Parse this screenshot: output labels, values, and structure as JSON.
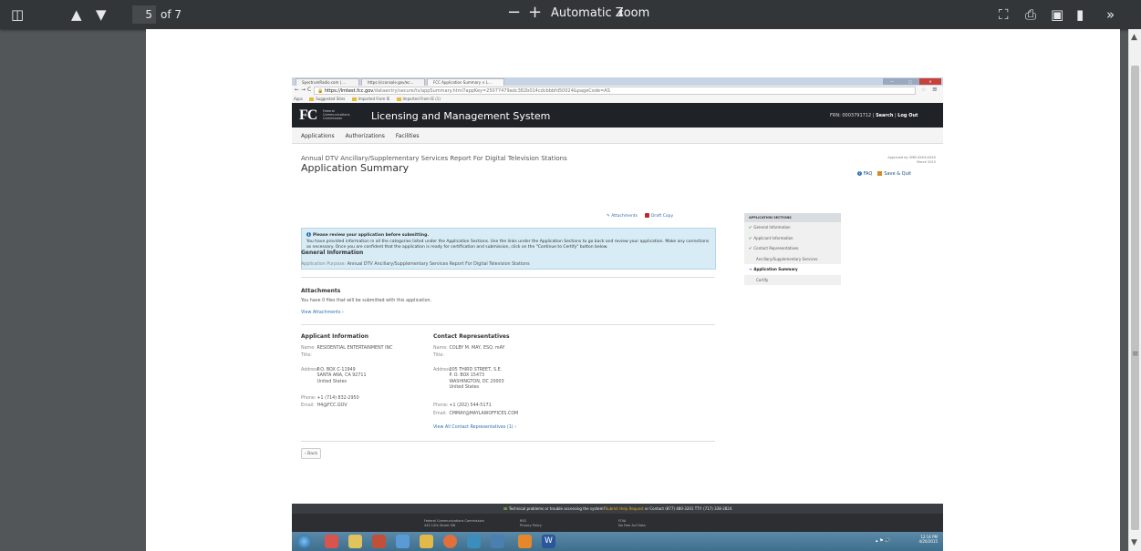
{
  "viewer": {
    "page_current": "5",
    "page_total": "of 7",
    "zoom_label": "Automatic Zoom",
    "zoom_out": "−",
    "zoom_in": "+"
  },
  "browser": {
    "tabs": [
      "SpectrumRadio.com | ...",
      "https://cconsole.gov/ec...",
      "FCC Application Summary × L..."
    ],
    "url_domain": "https://lmtest.fcc.gov",
    "url_rest": "/dataentry/secure/tv/appSummary.html?appKey=25077479adc382b014cdcbbbfd50024&pageCode=AS",
    "bookmarks": [
      "Apps",
      "Suggested Sites",
      "Imported From IE",
      "Imported From IE (1)"
    ]
  },
  "site": {
    "logo": "FC",
    "logo_sub": "Federal Communications Commission",
    "title": "Licensing and Management System",
    "frn": "FRN: 0003791712",
    "search": "Search",
    "logout": "Log Out",
    "nav": [
      "Applications",
      "Authorizations",
      "Facilities"
    ]
  },
  "page": {
    "subtitle": "Annual DTV Ancillary/Supplementary Services Report For Digital Television Stations",
    "title": "Application Summary",
    "omb_1": "Approved by OMB XXXX-XXXX",
    "omb_2": "March 2015",
    "faq": "FAQ",
    "save_quit": "Save & Quit",
    "attachments_link": "Attachments",
    "draft_copy": "Draft Copy"
  },
  "sections": {
    "header": "APPLICATION SECTIONS",
    "items": [
      {
        "label": "General Information",
        "state": "done"
      },
      {
        "label": "Applicant Information",
        "state": "done"
      },
      {
        "label": "Contact Representatives",
        "state": "done"
      },
      {
        "label": "Ancillary/Supplementary Services",
        "state": "none"
      },
      {
        "label": "Application Summary",
        "state": "current"
      },
      {
        "label": "Certify",
        "state": "none"
      }
    ]
  },
  "notice": {
    "heading": "Please review your application before submitting.",
    "body": "You have provided information in all the categories listed under the Application Sections. Use the links under the Application Sections to go back and review your application. Make any corrections as necessary. Once you are confident that the application is ready for certification and submission, click on the \"Continue to Certify\" button below."
  },
  "general": {
    "heading": "General Information",
    "purpose_label": "Application Purpose:",
    "purpose": "Annual DTV Ancillary/Supplementary Services Report For Digital Television Stations"
  },
  "attachments": {
    "heading": "Attachments",
    "text": "You have 0 files that will be submitted with this application.",
    "link": "View Attachments ›"
  },
  "applicant": {
    "heading": "Applicant Information",
    "name_label": "Name:",
    "name": "RESIDENTIAL ENTERTAINMENT INC",
    "title_label": "Title:",
    "address_label": "Address:",
    "address": [
      "P.O. BOX C-11949",
      "SANTA ANA, CA 92711",
      "United States"
    ],
    "phone_label": "Phone:",
    "phone": "+1 (714) 832-2950",
    "email_label": "Email:",
    "email": "H4@FCC.GOV"
  },
  "contact": {
    "heading": "Contact Representatives",
    "name_label": "Name:",
    "name": "COLBY M. MAY, ESQ. mAY",
    "title_label": "Title:",
    "address_label": "Address:",
    "address": [
      "205 THIRD STREET, S.E.",
      "P. O. BOX 15473",
      "WASHINGTON, DC 20003",
      "United States"
    ],
    "phone_label": "Phone:",
    "phone": "+1 (202) 544-5171",
    "email_label": "Email:",
    "email": "CMMAY@MAYLAWOFFICES.COM",
    "link": "View All Contact Representatives (1) ›"
  },
  "back_button": "‹ Back",
  "footer": {
    "help_pre": "Technical problems or trouble accessing the system?",
    "help_link": "Submit Help Request",
    "help_post": " or Contact (877) 480-3201 TTY: (717) 338-2824",
    "col1": [
      "Federal Communications Commission",
      "445 12th Street SW"
    ],
    "col2": [
      "RSS",
      "Privacy Policy"
    ],
    "col3": [
      "FOIA",
      "No Fear Act Data"
    ]
  },
  "taskbar": {
    "time": "12:14 PM",
    "date": "4/20/2015"
  }
}
